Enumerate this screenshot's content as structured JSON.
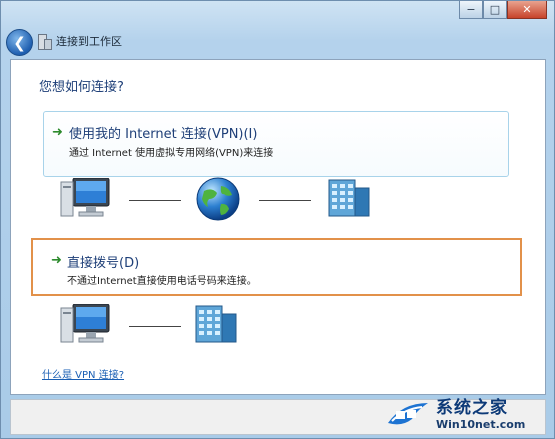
{
  "window": {
    "breadcrumb": "连接到工作区",
    "controls": {
      "minimize": "−",
      "maximize": "□",
      "close": "✕"
    }
  },
  "main": {
    "heading": "您想如何连接?",
    "options": [
      {
        "title": "使用我的 Internet 连接(VPN)(I)",
        "description": "通过 Internet 使用虚拟专用网络(VPN)来连接"
      },
      {
        "title": "直接拨号(D)",
        "description": "不通过Internet直接使用电话号码来连接。"
      }
    ],
    "help_link": "什么是 VPN 连接?"
  },
  "watermark": {
    "cn": "系统之家",
    "en": "Win10net.com"
  },
  "icons": {
    "back": "back-arrow-icon",
    "breadcrumb": "network-folder-icon",
    "option_arrow": "green-arrow-icon",
    "computer": "computer-icon",
    "globe": "globe-icon",
    "building": "office-building-icon"
  },
  "colors": {
    "heading": "#1e3f78",
    "link": "#1a5fb4",
    "selected_border": "#e2914a",
    "hover_border": "#a8d3ea"
  }
}
